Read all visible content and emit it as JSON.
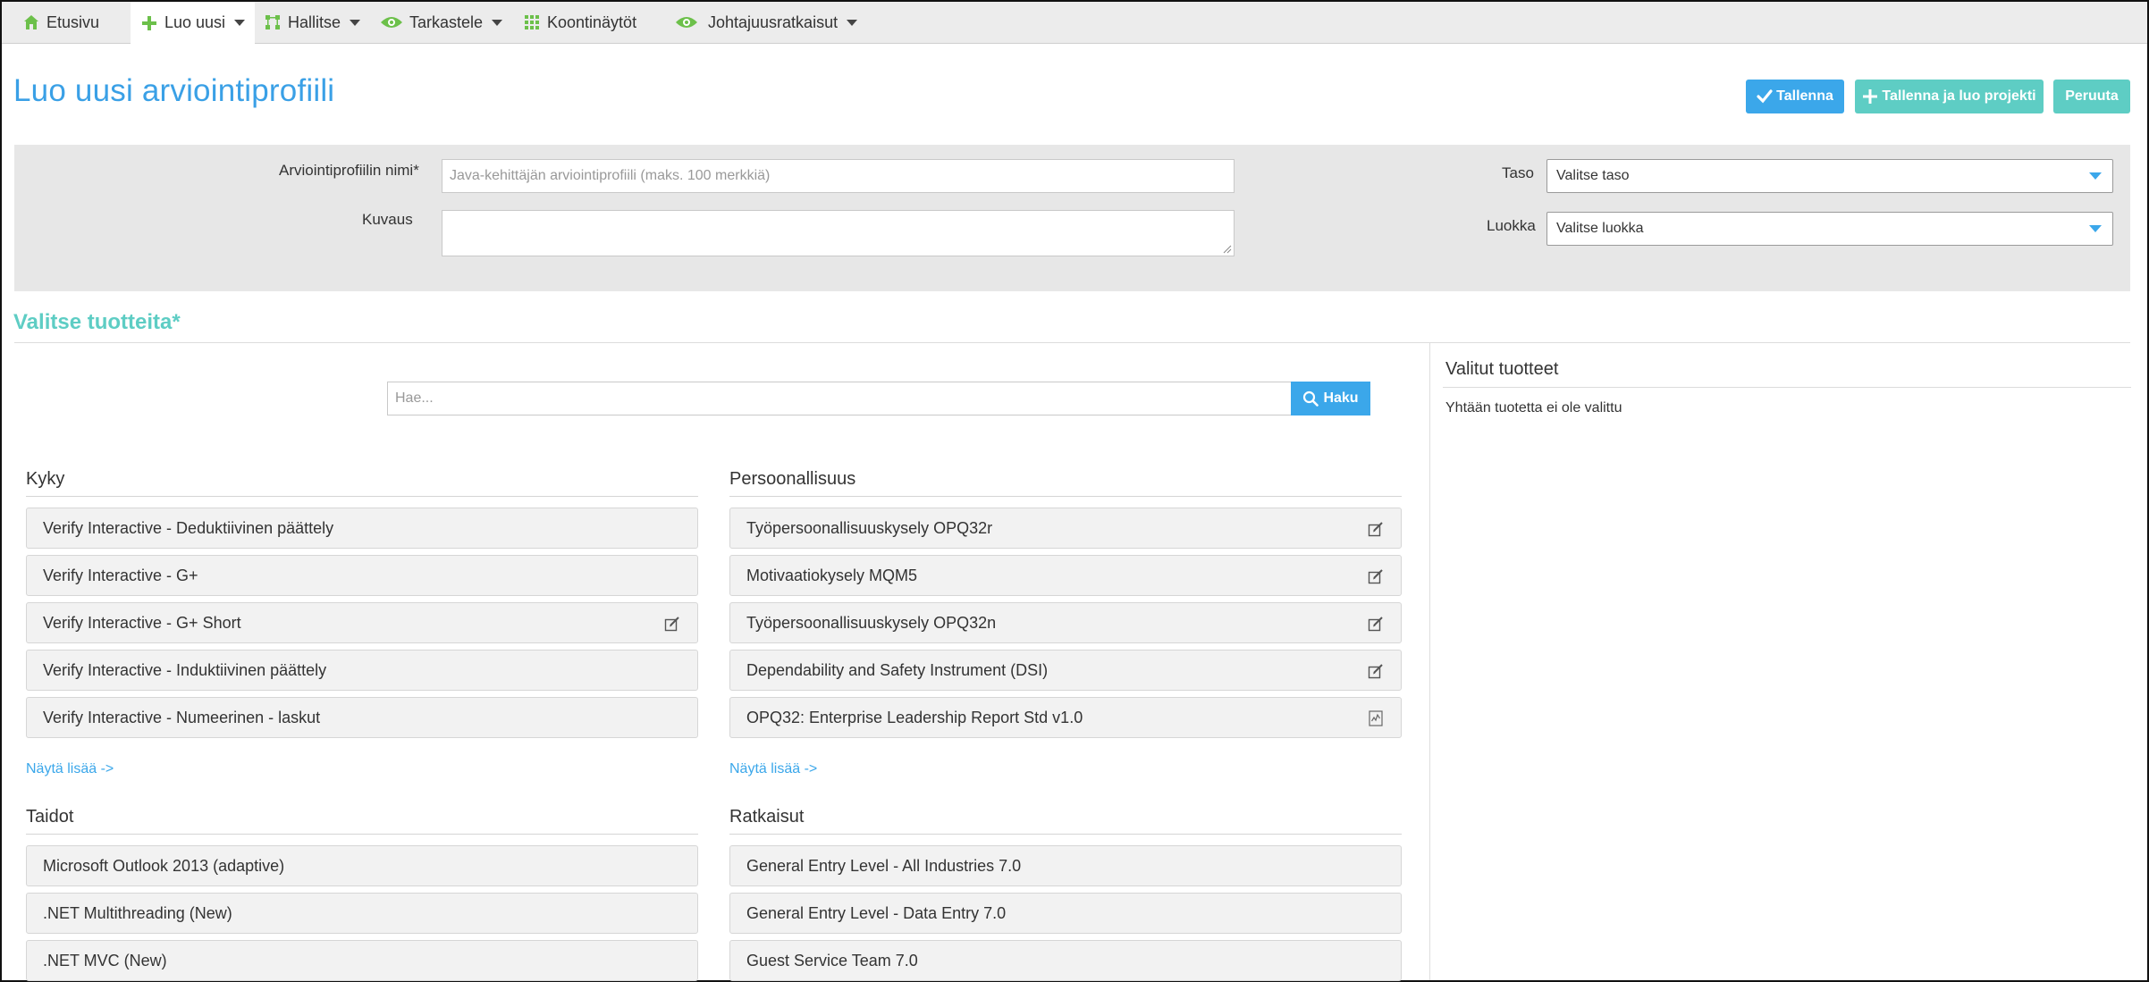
{
  "nav": {
    "items": [
      {
        "label": "Etusivu",
        "icon": "home-icon",
        "caret": false
      },
      {
        "label": "Luo uusi",
        "icon": "plus-icon",
        "caret": true,
        "active": true
      },
      {
        "label": "Hallitse",
        "icon": "manage-icon",
        "caret": true
      },
      {
        "label": "Tarkastele",
        "icon": "eye-icon",
        "caret": true
      },
      {
        "label": "Koontinäytöt",
        "icon": "dashboard-grid-icon",
        "caret": false
      },
      {
        "label": "Johtajuusratkaisut",
        "icon": "eye-icon",
        "caret": true
      }
    ]
  },
  "header": {
    "title": "Luo uusi arviointiprofiili",
    "save_label": "Tallenna",
    "save_create_label": "Tallenna ja luo projekti",
    "cancel_label": "Peruuta"
  },
  "form": {
    "name_label": "Arviointiprofiilin nimi*",
    "name_placeholder": "Java-kehittäjän arviointiprofiili (maks. 100 merkkiä)",
    "description_label": "Kuvaus",
    "level_label": "Taso",
    "level_value": "Valitse taso",
    "class_label": "Luokka",
    "class_value": "Valitse luokka"
  },
  "products": {
    "title": "Valitse tuotteita*",
    "search_placeholder": "Hae...",
    "search_button": "Haku"
  },
  "selected": {
    "title": "Valitut tuotteet",
    "empty_text": "Yhtään tuotetta ei ole valittu"
  },
  "categories": {
    "kyky": {
      "title": "Kyky",
      "items": [
        {
          "label": "Verify Interactive - Deduktiivinen päättely",
          "icon": null
        },
        {
          "label": "Verify Interactive - G+",
          "icon": null
        },
        {
          "label": "Verify Interactive - G+ Short",
          "icon": "edit-icon"
        },
        {
          "label": "Verify Interactive - Induktiivinen päättely",
          "icon": null
        },
        {
          "label": "Verify Interactive - Numeerinen - laskut",
          "icon": null
        }
      ],
      "more": "Näytä lisää ->"
    },
    "persoonallisuus": {
      "title": "Persoonallisuus",
      "items": [
        {
          "label": "Työpersoonallisuuskysely OPQ32r",
          "icon": "edit-icon"
        },
        {
          "label": "Motivaatiokysely MQM5",
          "icon": "edit-icon"
        },
        {
          "label": "Työpersoonallisuuskysely OPQ32n",
          "icon": "edit-icon"
        },
        {
          "label": "Dependability and Safety Instrument (DSI)",
          "icon": "edit-icon"
        },
        {
          "label": "OPQ32: Enterprise Leadership Report Std v1.0",
          "icon": "report-icon"
        }
      ],
      "more": "Näytä lisää ->"
    },
    "taidot": {
      "title": "Taidot",
      "items": [
        {
          "label": "Microsoft Outlook 2013 (adaptive)"
        },
        {
          "label": ".NET Multithreading (New)"
        },
        {
          "label": ".NET MVC (New)"
        }
      ]
    },
    "ratkaisut": {
      "title": "Ratkaisut",
      "items": [
        {
          "label": "General Entry Level - All Industries 7.0"
        },
        {
          "label": "General Entry Level - Data Entry 7.0"
        },
        {
          "label": "Guest Service Team 7.0"
        }
      ]
    }
  },
  "colors": {
    "accent_blue": "#3ba7ea",
    "accent_teal": "#5ecdc4",
    "nav_green": "#6cc04a"
  }
}
